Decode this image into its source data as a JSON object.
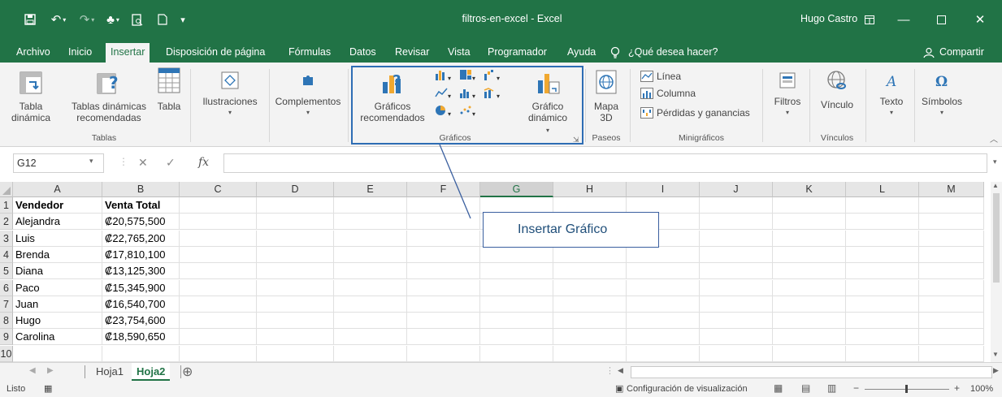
{
  "window": {
    "doc_title": "filtros-en-excel  -  Excel",
    "user": "Hugo Castro"
  },
  "menu": {
    "tabs": [
      "Archivo",
      "Inicio",
      "Insertar",
      "Disposición de página",
      "Fórmulas",
      "Datos",
      "Revisar",
      "Vista",
      "Programador",
      "Ayuda"
    ],
    "active_tab": "Insertar",
    "tell_me": "¿Qué desea hacer?",
    "share": "Compartir"
  },
  "ribbon": {
    "tabla_dinamica": "Tabla dinámica",
    "tablas_recomendadas": "Tablas dinámicas recomendadas",
    "tabla": "Tabla",
    "tablas_group": "Tablas",
    "ilustraciones": "Ilustraciones",
    "complementos": "Complementos",
    "graficos_recomendados": "Gráficos recomendados",
    "grafico_dinamico": "Gráfico dinámico",
    "graficos_group": "Gráficos",
    "mapa_3d": "Mapa 3D",
    "paseos_group": "Paseos",
    "linea": "Línea",
    "columna": "Columna",
    "perdidas": "Pérdidas y ganancias",
    "minigraficos_group": "Minigráficos",
    "filtros": "Filtros",
    "vinculo": "Vínculo",
    "vinculos_group": "Vínculos",
    "texto": "Texto",
    "simbolos": "Símbolos"
  },
  "formula_bar": {
    "name_box": "G12",
    "fx": "fx",
    "value": ""
  },
  "sheet": {
    "columns": [
      "A",
      "B",
      "C",
      "D",
      "E",
      "F",
      "G",
      "H",
      "I",
      "J",
      "K",
      "L",
      "M"
    ],
    "selected_column": "G",
    "rows": [
      {
        "num": "1",
        "a": "Vendedor",
        "b": "Venta Total",
        "header": true
      },
      {
        "num": "2",
        "a": "Alejandra",
        "b": "₡20,575,500"
      },
      {
        "num": "3",
        "a": "Luis",
        "b": "₡22,765,200"
      },
      {
        "num": "4",
        "a": "Brenda",
        "b": "₡17,810,100"
      },
      {
        "num": "5",
        "a": "Diana",
        "b": "₡13,125,300"
      },
      {
        "num": "6",
        "a": "Paco",
        "b": "₡15,345,900"
      },
      {
        "num": "7",
        "a": "Juan",
        "b": "₡16,540,700"
      },
      {
        "num": "8",
        "a": "Hugo",
        "b": "₡23,754,600"
      },
      {
        "num": "9",
        "a": "Carolina",
        "b": "₡18,590,650"
      },
      {
        "num": "10",
        "a": "",
        "b": ""
      }
    ]
  },
  "annotation": {
    "callout_text": "Insertar Gráfico"
  },
  "sheet_tabs": {
    "tabs": [
      "Hoja1",
      "Hoja2"
    ],
    "active": "Hoja2"
  },
  "status": {
    "ready": "Listo",
    "display_settings": "Configuración de visualización",
    "zoom": "100%"
  },
  "colors": {
    "brand": "#217346",
    "callout_border": "#3a5f9f",
    "highlight_box": "#2e6db4"
  }
}
